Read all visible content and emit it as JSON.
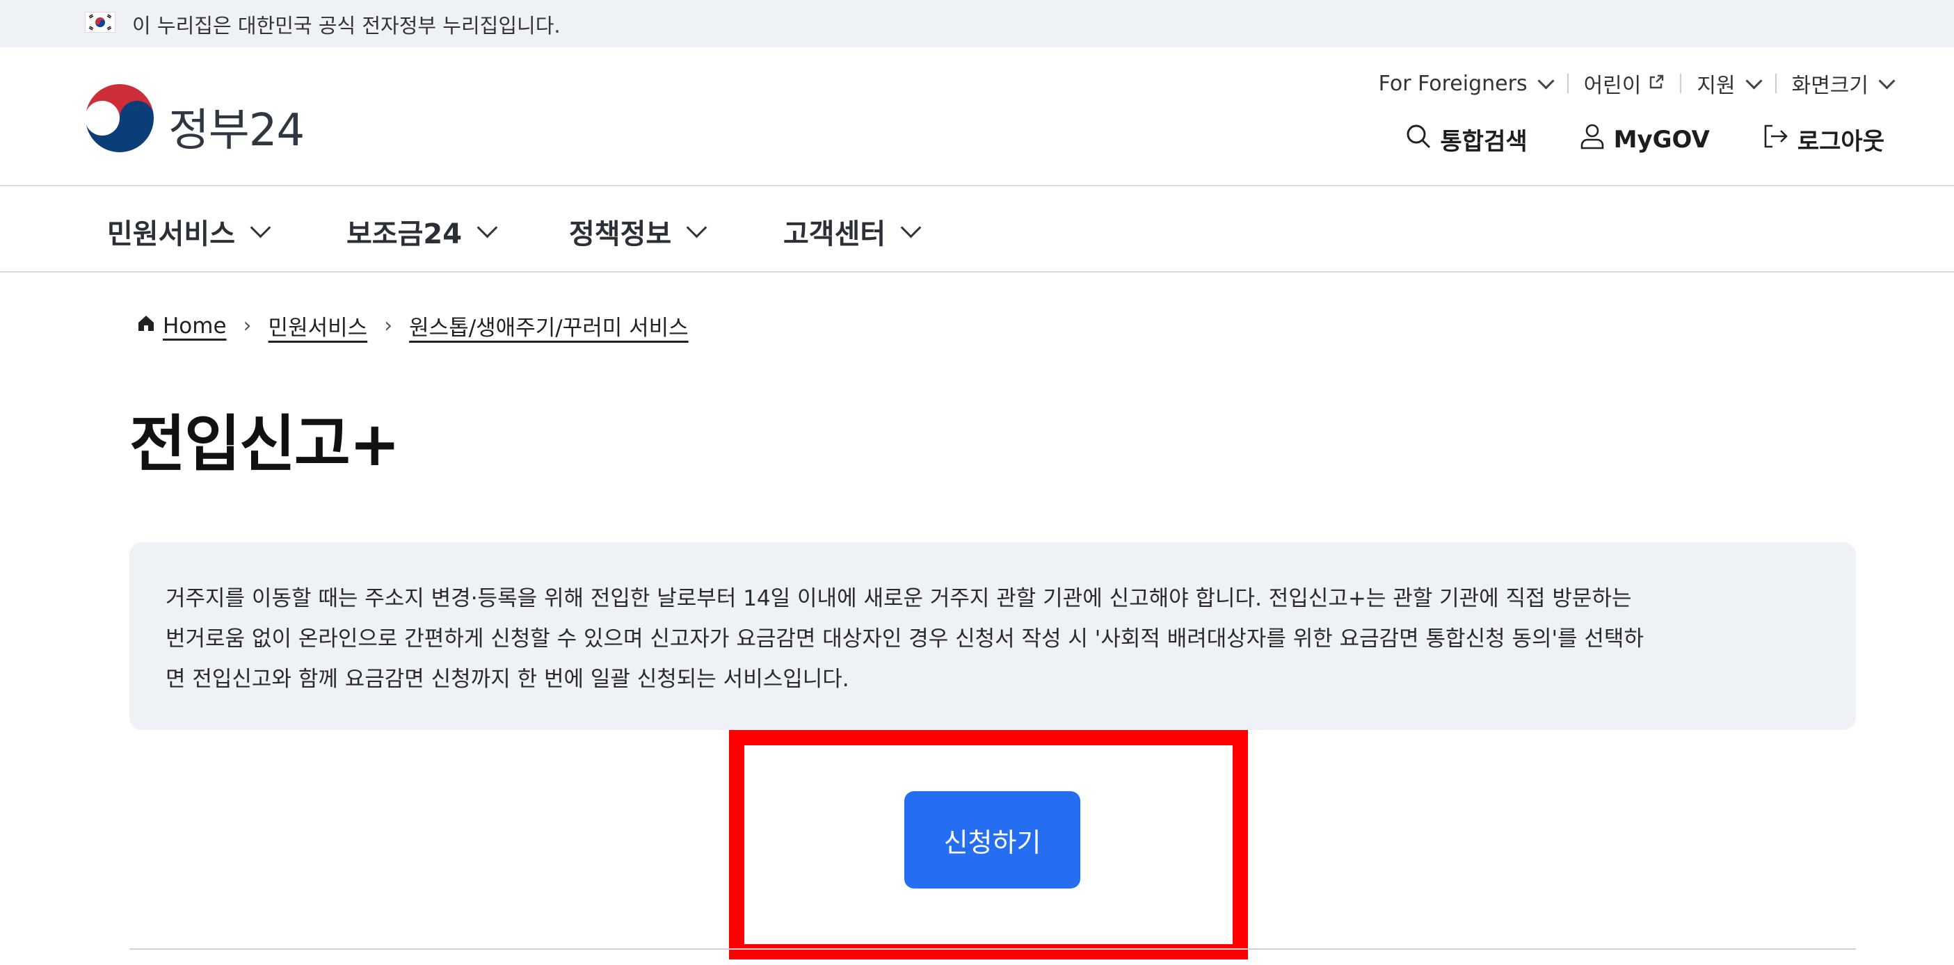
{
  "topbar": {
    "notice": "이 누리집은 대한민국 공식 전자정부 누리집입니다."
  },
  "header": {
    "logo_text": "정부24",
    "util": [
      {
        "label": "For Foreigners",
        "icon": "chevron-down-icon"
      },
      {
        "label": "어린이",
        "icon": "external-link-icon"
      },
      {
        "label": "지원",
        "icon": "chevron-down-icon"
      },
      {
        "label": "화면크기",
        "icon": "chevron-down-icon"
      }
    ],
    "actions": {
      "search": "통합검색",
      "mygov": "MyGOV",
      "logout": "로그아웃"
    }
  },
  "gnb": {
    "items": [
      "민원서비스",
      "보조금24",
      "정책정보",
      "고객센터"
    ]
  },
  "breadcrumb": {
    "items": [
      "Home",
      "민원서비스",
      "원스톱/생애주기/꾸러미 서비스"
    ]
  },
  "page": {
    "title": "전입신고+",
    "description_lines": [
      "거주지를 이동할 때는 주소지 변경·등록을 위해 전입한 날로부터 14일 이내에 새로운 거주지 관할 기관에 신고해야 합니다. 전입신고+는 관할 기관에 직접 방문하는",
      "번거로움 없이 온라인으로 간편하게 신청할 수 있으며 신고자가 요금감면 대상자인 경우 신청서 작성 시 '사회적 배려대상자를 위한 요금감면 통합신청 동의'를 선택하",
      "면 전입신고와 함께 요금감면 신청까지 한 번에 일괄 신청되는 서비스입니다."
    ],
    "apply_label": "신청하기"
  },
  "colors": {
    "accent": "#256ef1",
    "highlight": "#ff0000",
    "topbar_bg": "#eef1f5"
  }
}
